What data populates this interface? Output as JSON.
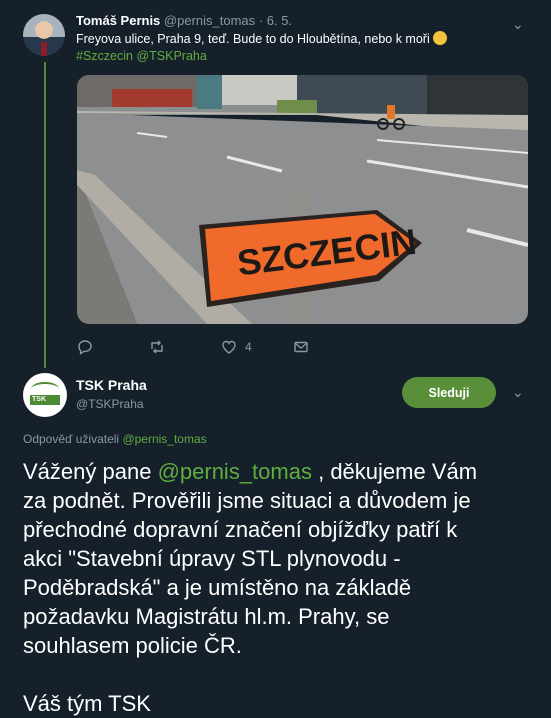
{
  "tweet1": {
    "name": "Tomáš Pernis",
    "handle": "@pernis_tomas",
    "sep": "·",
    "date": "6. 5.",
    "text": "Freyova ulice, Praha 9, teď. Bude to do Hloubětína, nebo k moři",
    "hashtag": "#Szczecin",
    "mention": "@TSKPraha",
    "photo": {
      "sign_text": "SZCZECIN"
    },
    "actions": {
      "reply_count": "",
      "retweet_count": "",
      "like_count": "4"
    }
  },
  "tweet2": {
    "name": "TSK Praha",
    "handle": "@TSKPraha",
    "follow_label": "Sleduji",
    "avatar_text": "TSK",
    "reply_prefix": "Odpověď uživateli",
    "reply_mention": "@pernis_tomas",
    "body": {
      "l1_pre": "Vážený pane",
      "l1_mention": "@pernis_tomas",
      "l1_post": ", děkujeme Vám",
      "l2": "za podnět. Prověřili jsme situaci a důvodem je",
      "l3": "přechodné dopravní značení objížďky patří k",
      "l4": "akci \"Stavební úpravy STL plynovodu -",
      "l5": "Poděbradská\" a je umístěno na základě",
      "l6": "požadavku Magistrátu hl.m. Prahy, se",
      "l7": "souhlasem policie ČR.",
      "l8": "Váš tým TSK"
    }
  },
  "colors": {
    "background": "#15202b",
    "accent": "#5fae3f",
    "follow_button": "#5a8f3a",
    "thread_line": "#4f8a3c"
  }
}
